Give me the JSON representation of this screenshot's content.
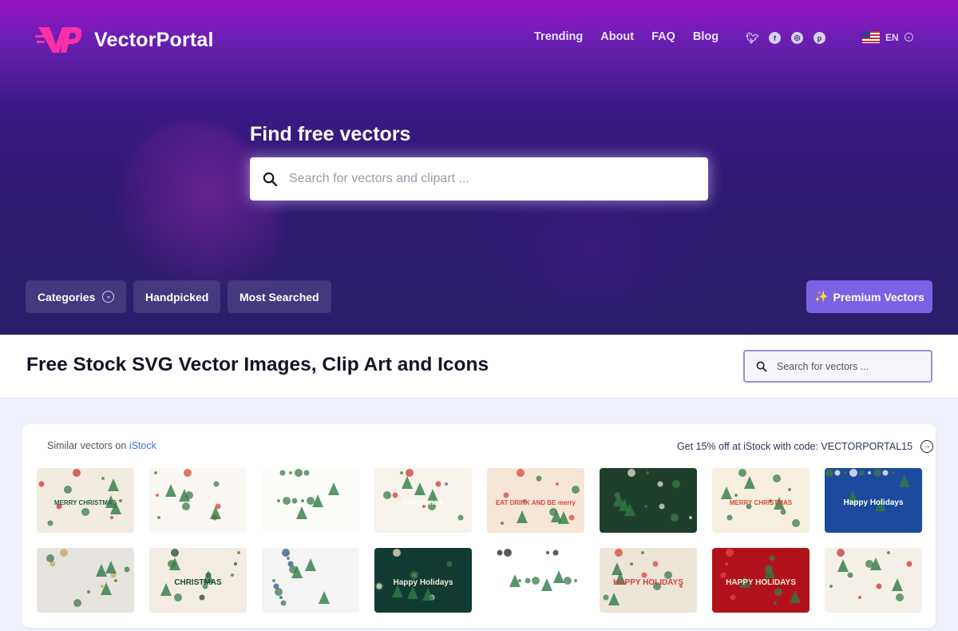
{
  "brand": {
    "name": "VectorPortal"
  },
  "nav": [
    "Trending",
    "About",
    "FAQ",
    "Blog"
  ],
  "socials": [
    "twitter-icon",
    "facebook-icon",
    "dribbble-icon",
    "pinterest-icon"
  ],
  "language": {
    "code": "EN"
  },
  "hero": {
    "title": "Find free vectors",
    "search_placeholder": "Search for vectors and clipart ..."
  },
  "pills": {
    "categories": "Categories",
    "handpicked": "Handpicked",
    "most_searched": "Most Searched"
  },
  "premium": {
    "icon": "✨",
    "label": "Premium Vectors"
  },
  "page": {
    "title": "Free Stock SVG Vector Images, Clip Art and Icons",
    "search_placeholder": "Search for vectors ..."
  },
  "istock": {
    "left_prefix": "Similar vectors on ",
    "left_link": "iStock",
    "promo": "Get 15% off at iStock with code: VECTORPORTAL15"
  },
  "thumbs": [
    {
      "bg": "#f1ebe0",
      "accent": "#c9333b",
      "text": "MERRY CHRISTMAS",
      "text_color": "#2d5a3a"
    },
    {
      "bg": "#fbf8f3",
      "accent": "#d84a3a",
      "text": "",
      "text_color": "#000"
    },
    {
      "bg": "#fcfcf8",
      "accent": "#3d7a48",
      "text": "",
      "text_color": "#000"
    },
    {
      "bg": "#f7f2ea",
      "accent": "#cf3a32",
      "text": "Christmas",
      "text_color": "#fff"
    },
    {
      "bg": "#f5e6d8",
      "accent": "#d9473b",
      "text": "EAT DRINK AND BE merry",
      "text_color": "#d9473b"
    },
    {
      "bg": "#1f3f2c",
      "accent": "#e7e2d6",
      "text": "",
      "text_color": "#fff"
    },
    {
      "bg": "#f6efe0",
      "accent": "#2e7b4c",
      "text": "MERRY CHRISTMAS",
      "text_color": "#d84a2f"
    },
    {
      "bg": "#1c4a9c",
      "accent": "#ffffff",
      "text": "Happy Holidays",
      "text_color": "#ffffff"
    },
    {
      "bg": "#e7e4df",
      "accent": "#c9a35b",
      "text": "",
      "text_color": "#000"
    },
    {
      "bg": "#f3ece2",
      "accent": "#1f4a34",
      "text": "CHRISTMAS",
      "text_color": "#1f4a34"
    },
    {
      "bg": "#f4f4f4",
      "accent": "#36518a",
      "text": "",
      "text_color": "#000"
    },
    {
      "bg": "#123b34",
      "accent": "#e9ddc6",
      "text": "Happy Holidays",
      "text_color": "#f2ead9"
    },
    {
      "bg": "#ffffff",
      "accent": "#222222",
      "text": "",
      "text_color": "#000"
    },
    {
      "bg": "#ece5d8",
      "accent": "#d8413c",
      "text": "HAPPY HOLIDAYS",
      "text_color": "#d8413c"
    },
    {
      "bg": "#b1121a",
      "accent": "#e14a3c",
      "text": "HAPPY HOLIDAYS",
      "text_color": "#ffe9d6"
    },
    {
      "bg": "#f5f0e7",
      "accent": "#c8382f",
      "text": "",
      "text_color": "#000"
    }
  ]
}
